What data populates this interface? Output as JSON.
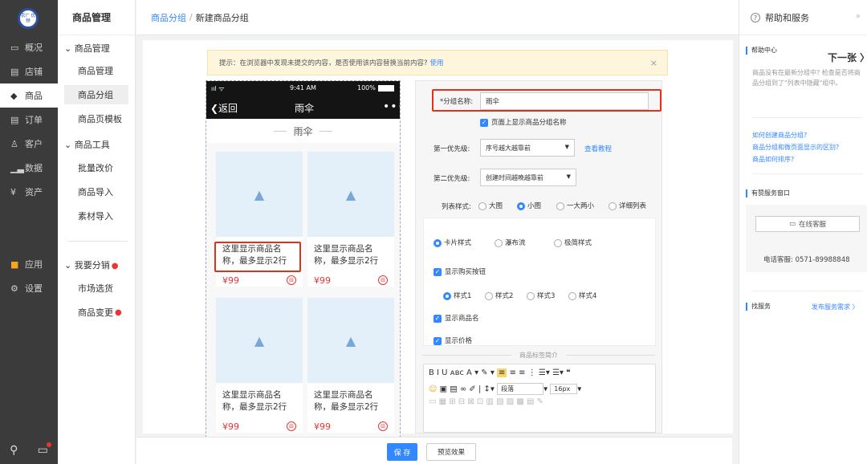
{
  "sidebar": {
    "logo_text": "农广\n优频",
    "items": [
      {
        "icon": "monitor-icon",
        "glyph": "▭",
        "label": "概况"
      },
      {
        "icon": "store-icon",
        "glyph": "▤",
        "label": "店铺"
      },
      {
        "icon": "tag-icon",
        "glyph": "◆",
        "label": "商品"
      },
      {
        "icon": "list-icon",
        "glyph": "▤",
        "label": "订单"
      },
      {
        "icon": "person-icon",
        "glyph": "♙",
        "label": "客户"
      },
      {
        "icon": "bar-chart-icon",
        "glyph": "▁▃",
        "label": "数据"
      },
      {
        "icon": "yen-icon",
        "glyph": "¥",
        "label": "资产"
      },
      {
        "icon": "apps-icon",
        "glyph": "■",
        "label": "应用"
      },
      {
        "icon": "gear-icon",
        "glyph": "⚙",
        "label": "设置"
      }
    ]
  },
  "subnav": {
    "title": "商品管理",
    "group1": "商品管理",
    "group1_items": [
      "商品管理",
      "商品分组",
      "商品页模板"
    ],
    "group2": "商品工具",
    "group2_items": [
      "批量改价",
      "商品导入",
      "素材导入"
    ],
    "group3": "我要分销",
    "group3_items": [
      "市场选货",
      "商品变更"
    ]
  },
  "breadcrumb": {
    "parent": "商品分组",
    "separator": "/",
    "current": "新建商品分组"
  },
  "notice": {
    "text": "提示：在浏览器中发现未提交的内容，是否使用该内容替换当前内容?",
    "link": "使用",
    "close": "×"
  },
  "phone": {
    "signal": "ııl ᯤ",
    "time": "9:41 AM",
    "battery": "100%",
    "back": "❮返回",
    "title": "雨伞",
    "dots": "•••",
    "category_title": "雨伞",
    "products": [
      {
        "name": "这里显示商品名称，最多显示2行",
        "price": "¥99"
      },
      {
        "name": "这里显示商品名称，最多显示2行",
        "price": "¥99"
      },
      {
        "name": "这里显示商品名称，最多显示2行",
        "price": "¥99"
      },
      {
        "name": "这里显示商品名称，最多显示2行",
        "price": "¥99"
      }
    ]
  },
  "form": {
    "group_name_label": "*分组名称:",
    "group_name_value": "雨伞",
    "show_name_label": "页面上显示商品分组名称",
    "priority1_label": "第一优先级:",
    "priority1_value": "序号越大越靠前",
    "tutorial_link": "查看教程",
    "priority2_label": "第二优先级:",
    "priority2_value": "创建时间越晚越靠前",
    "list_style_label": "列表样式:",
    "list_styles": [
      "大图",
      "小图",
      "一大两小",
      "详细列表"
    ],
    "card_styles": [
      "卡片样式",
      "瀑布流",
      "极简样式"
    ],
    "show_buy_btn": "显示购买按钮",
    "buy_styles": [
      "样式1",
      "样式2",
      "样式3",
      "样式4"
    ],
    "show_name": "显示商品名",
    "show_price": "显示价格",
    "intro_divider": "商品标签简介",
    "editor": {
      "row1": "B  I  U  ᴀʙᴄ  A ▾  ✎ ▾",
      "paragraph": "段落",
      "fontsize": "16px"
    }
  },
  "actions": {
    "save": "保 存",
    "preview": "预览效果"
  },
  "help": {
    "title": "帮助和服务",
    "chevron": "»",
    "center_title": "帮助中心",
    "center_text": "商品没有在最新分组中? 检查是否将商品分组到了\"列表中隐藏\"组中。",
    "next_page": "下一张 〉",
    "links": [
      "如何创建商品分组?",
      "商品分组和微页面显示的区别?",
      "商品如何排序?"
    ],
    "service_title": "有赞服务窗口",
    "online_service": "在线客服",
    "phone_text": "电话客服: 0571-89988848",
    "find_service": "找服务",
    "publish_link": "发布服务需求 〉"
  }
}
